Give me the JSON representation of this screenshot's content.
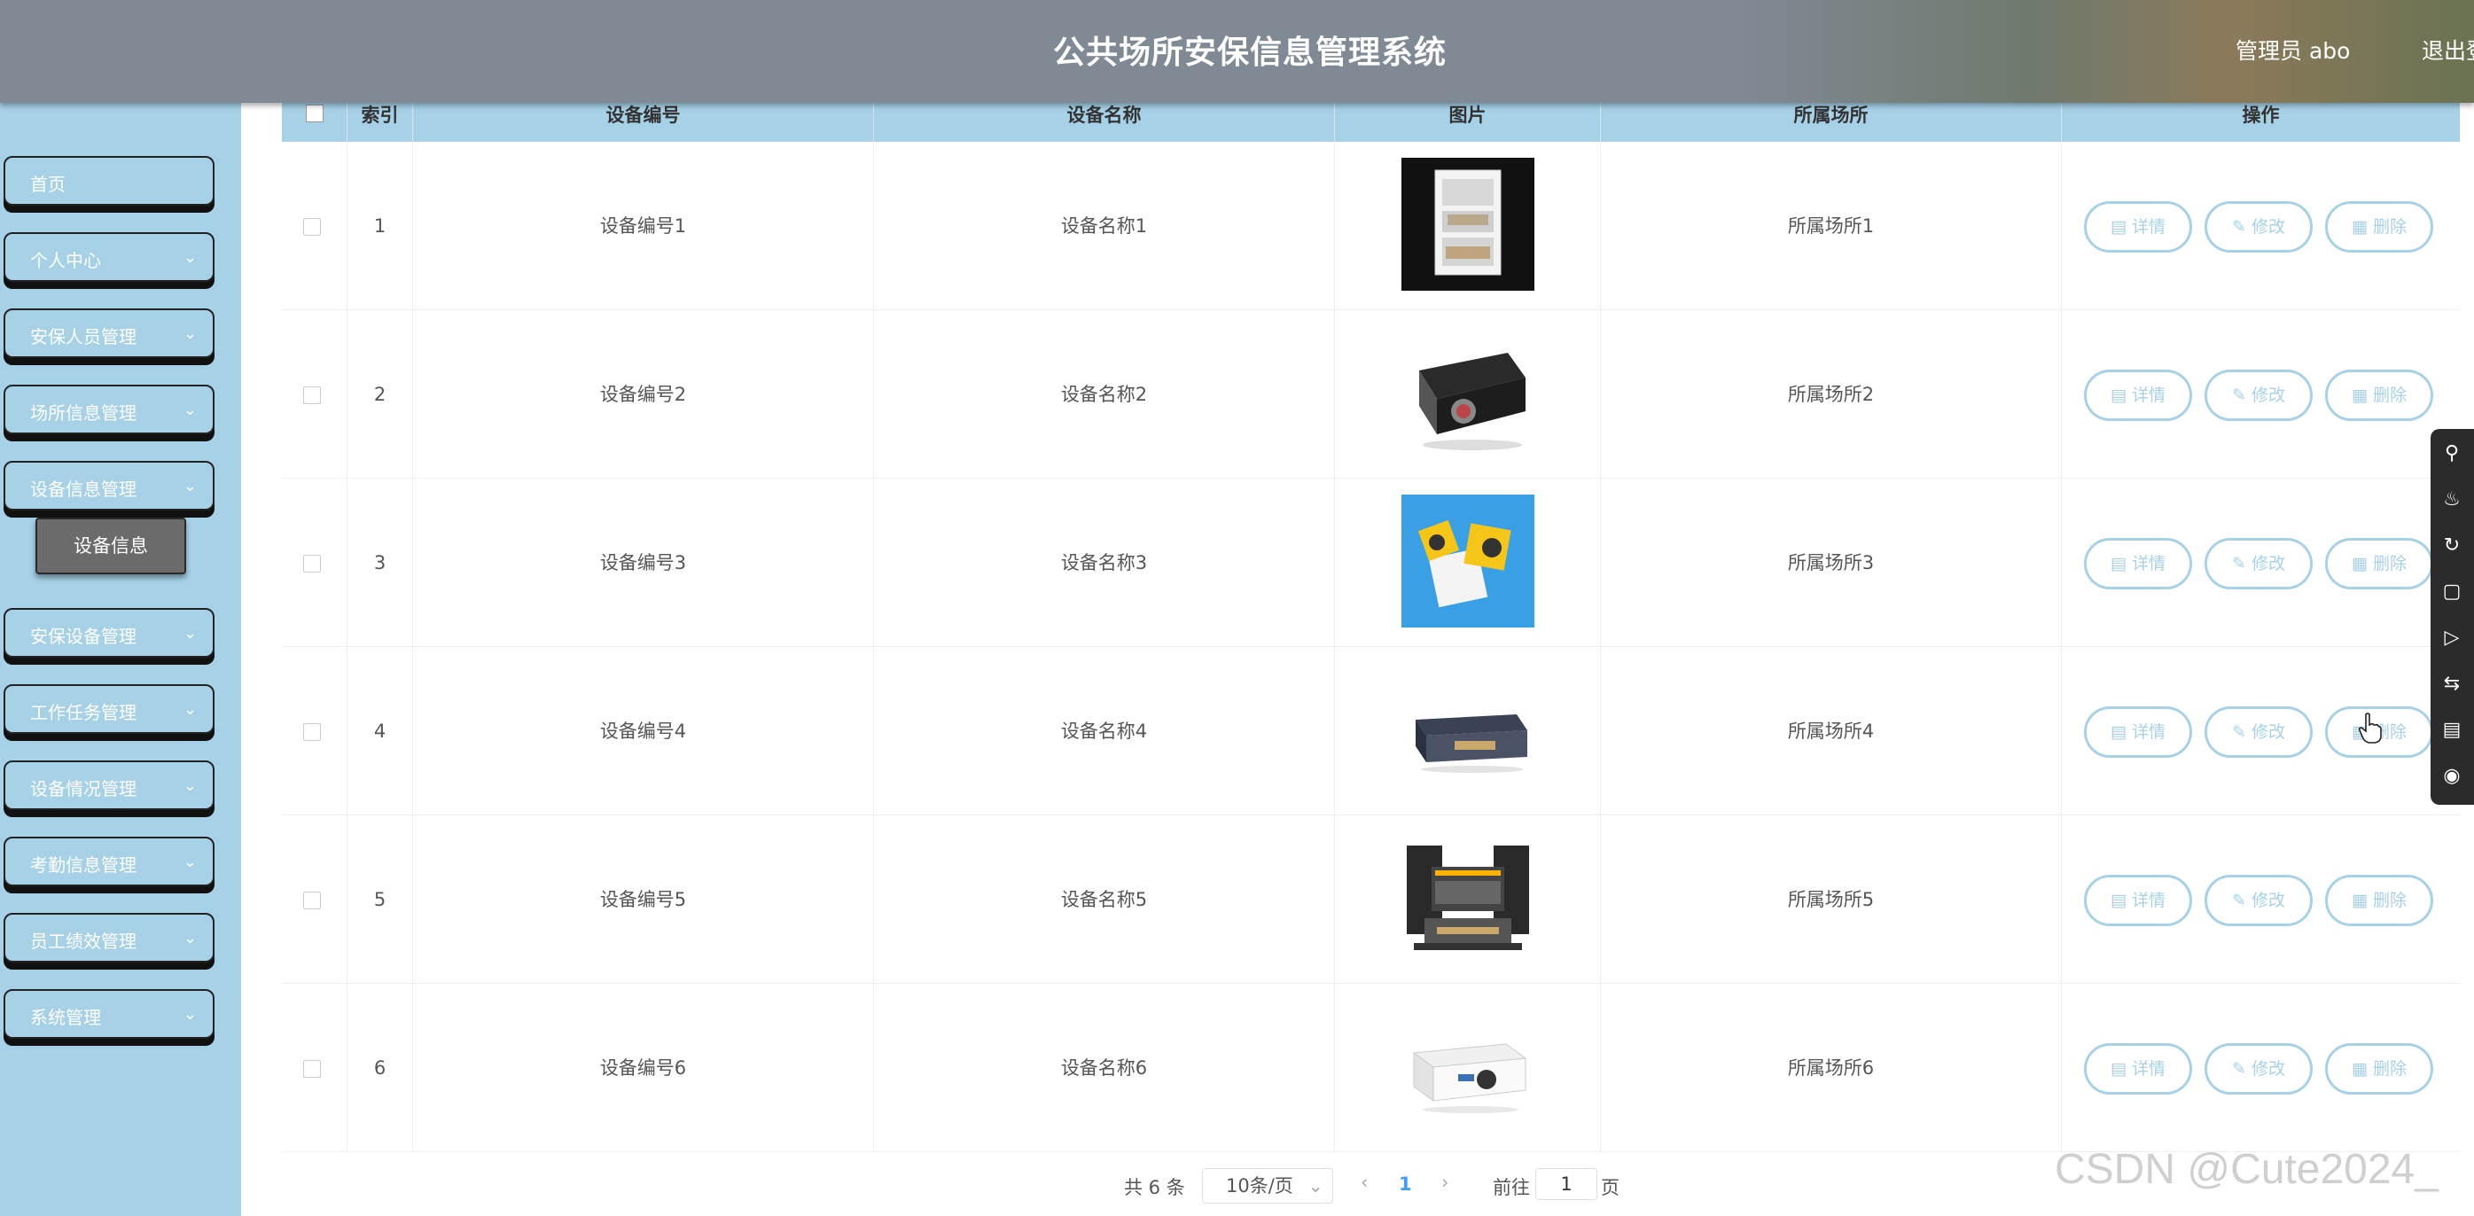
{
  "header": {
    "title": "公共场所安保信息管理系统",
    "admin": "管理员 abo",
    "logout": "退出登录"
  },
  "sidebar": {
    "items": [
      {
        "label": "首页",
        "has_chevron": false
      },
      {
        "label": "个人中心",
        "has_chevron": true
      },
      {
        "label": "安保人员管理",
        "has_chevron": true
      },
      {
        "label": "场所信息管理",
        "has_chevron": true
      },
      {
        "label": "设备信息管理",
        "has_chevron": true
      },
      {
        "label": "安保设备管理",
        "has_chevron": true
      },
      {
        "label": "工作任务管理",
        "has_chevron": true
      },
      {
        "label": "设备情况管理",
        "has_chevron": true
      },
      {
        "label": "考勤信息管理",
        "has_chevron": true
      },
      {
        "label": "员工绩效管理",
        "has_chevron": true
      },
      {
        "label": "系统管理",
        "has_chevron": true
      }
    ],
    "active_sub": "设备信息"
  },
  "table": {
    "columns": [
      "索引",
      "设备编号",
      "设备名称",
      "图片",
      "所属场所",
      "操作"
    ],
    "rows": [
      {
        "index": "1",
        "code": "设备编号1",
        "name": "设备名称1",
        "image": "cabinet",
        "place": "所属场所1"
      },
      {
        "index": "2",
        "code": "设备编号2",
        "name": "设备名称2",
        "image": "projector",
        "place": "所属场所2"
      },
      {
        "index": "3",
        "code": "设备编号3",
        "name": "设备名称3",
        "image": "mini-projector",
        "place": "所属场所3"
      },
      {
        "index": "4",
        "code": "设备编号4",
        "name": "设备名称4",
        "image": "amplifier",
        "place": "所属场所4"
      },
      {
        "index": "5",
        "code": "设备编号5",
        "name": "设备名称5",
        "image": "audio-mixer",
        "place": "所属场所5"
      },
      {
        "index": "6",
        "code": "设备编号6",
        "name": "设备名称6",
        "image": "white-projector",
        "place": "所属场所6"
      }
    ],
    "actions": {
      "detail": "详情",
      "edit": "修改",
      "delete": "删除"
    }
  },
  "pagination": {
    "total": "共 6 条",
    "page_size": "10条/页",
    "current": "1",
    "goto": "前往",
    "goto_value": "1",
    "unit": "页"
  },
  "watermark": "CSDN @Cute2024_",
  "colors": {
    "accent": "#a6d1e7",
    "header": "#808a95",
    "active_sub": "#6b6b6b"
  }
}
